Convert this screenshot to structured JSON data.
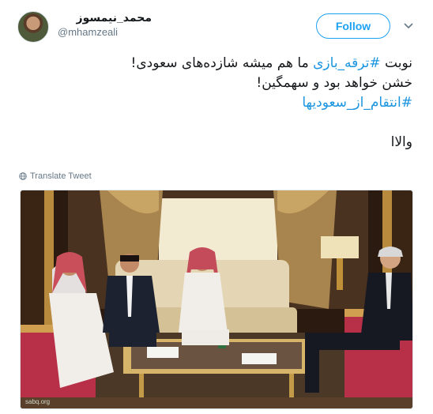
{
  "header": {
    "display_name": "محمد_نیمسوز",
    "handle": "@mhamzeali",
    "follow_label": "Follow",
    "menu_icon": "chevron-down-icon"
  },
  "tweet": {
    "line1_before": "نوبت ",
    "line1_hashtag": "#ترقه_بازی",
    "line1_after": " ما هم میشه شازده‌های سعودی!",
    "line2": "خشن خواهد بود و سهمگین!",
    "line3_hashtag": "#انتقام_از_سعودیها",
    "line4": "والاا"
  },
  "translate": {
    "label": "Translate Tweet",
    "icon": "globe-icon"
  },
  "photo": {
    "watermark": "sabq.org"
  },
  "colors": {
    "accent": "#1da1f2",
    "hashtag": "#1b95e0",
    "secondary_text": "#657786"
  }
}
